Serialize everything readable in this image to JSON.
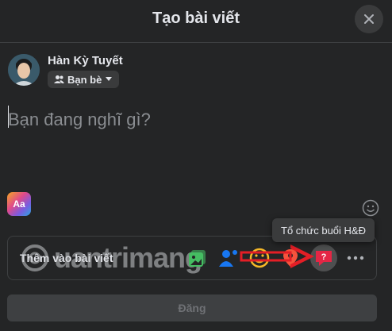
{
  "dialog": {
    "title": "Tạo bài viết"
  },
  "user": {
    "name": "Hàn Kỳ Tuyết",
    "audience": "Bạn bè"
  },
  "composer": {
    "placeholder": "Bạn đang nghĩ gì?",
    "background_button_label": "Aa"
  },
  "add_to_post": {
    "label": "Thêm vào bài viết",
    "tools": [
      {
        "icon": "photo-video-icon",
        "color": "#45bd62"
      },
      {
        "icon": "tag-people-icon",
        "color": "#1877f2"
      },
      {
        "icon": "feeling-activity-icon",
        "color": "#f7b928"
      },
      {
        "icon": "check-in-icon",
        "color": "#f5533d"
      },
      {
        "icon": "host-qa-icon",
        "color": "#e42645"
      },
      {
        "icon": "more-icon",
        "color": "#b0b3b8"
      }
    ]
  },
  "tooltip": {
    "text": "Tổ chức buổi H&Đ"
  },
  "post_button": {
    "label": "Đăng"
  },
  "watermark": {
    "text": "uantrimang"
  },
  "colors": {
    "background": "#242526",
    "surface": "#3a3b3c",
    "annotation": "#e41e26"
  }
}
